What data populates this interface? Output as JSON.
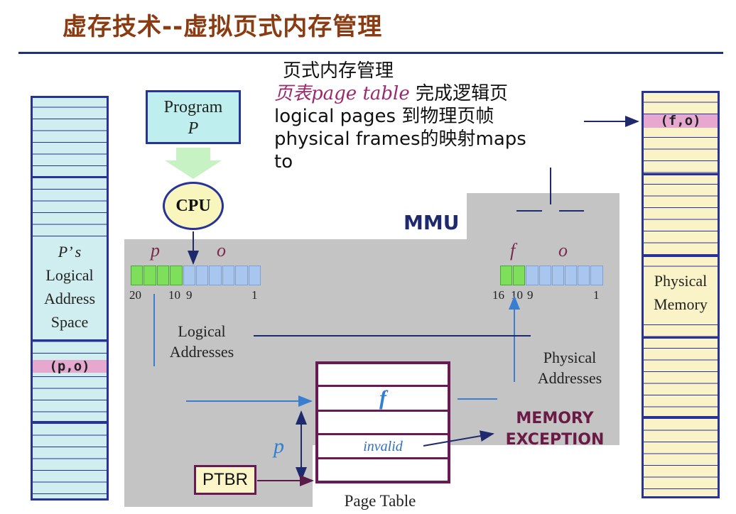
{
  "title": "虚存技术--虚拟页式内存管理",
  "description": {
    "line1": "页式内存管理",
    "line2_highlight": "页表page table",
    "line2_rest": " 完成逻辑页",
    "line3": "logical pages 到物理页帧",
    "line4": "physical frames的映射maps",
    "line5": "to"
  },
  "program": {
    "line1": "Program",
    "line2": "P"
  },
  "cpu": "CPU",
  "mmu": "MMU",
  "logical_register": {
    "page_label": "p",
    "offset_label": "o",
    "bit_high": "20",
    "bit_mid_hi": "10",
    "bit_mid_lo": "9",
    "bit_low": "1"
  },
  "physical_register": {
    "frame_label": "f",
    "offset_label": "o",
    "bit_high": "16",
    "bit_mid_hi": "10",
    "bit_mid_lo": "9",
    "bit_low": "1"
  },
  "logical_addresses": {
    "line1": "Logical",
    "line2": "Addresses"
  },
  "physical_addresses": {
    "line1": "Physical",
    "line2": "Addresses"
  },
  "logical_space": {
    "line1": "P’ s",
    "line2": "Logical",
    "line3": "Address",
    "line4": "Space",
    "entry": "(p,o)"
  },
  "physical_memory": {
    "line1": "Physical",
    "line2": "Memory",
    "entry": "(f,o)"
  },
  "page_table": {
    "label": "Page Table",
    "frame_entry": "f",
    "invalid_entry": "invalid",
    "index_label": "p"
  },
  "ptbr": "PTBR",
  "memory_exception": {
    "line1": "MEMORY",
    "line2": "EXCEPTION"
  },
  "colors": {
    "title": "#8a3b12",
    "rule": "#1f2f86",
    "cyan_fill": "#d0eef0",
    "yellow_fill": "#fbf3c8",
    "green_bits": "#7ee05a",
    "blue_bits": "#a9c6ef",
    "mmu_gray": "#c4c4c4",
    "page_table_border": "#6a1a52",
    "entry_pink": "#e7a8cf"
  }
}
